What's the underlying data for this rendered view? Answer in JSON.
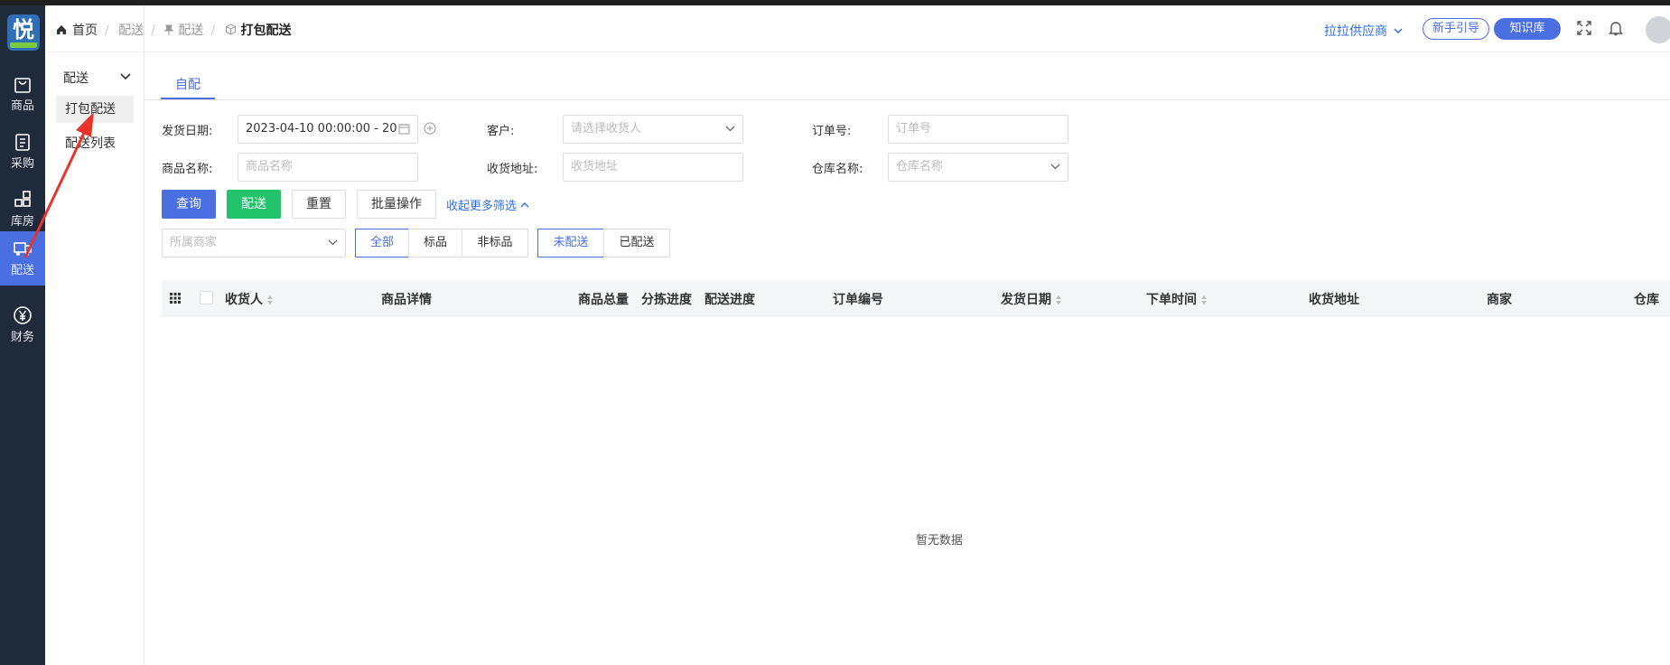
{
  "logo_text": "悦",
  "rail": {
    "items": [
      {
        "label": "商品",
        "icon": "bag-icon"
      },
      {
        "label": "采购",
        "icon": "clipboard-icon"
      },
      {
        "label": "库房",
        "icon": "blocks-icon"
      },
      {
        "label": "配送",
        "icon": "truck-icon",
        "active": true
      },
      {
        "label": "财务",
        "icon": "yen-icon"
      }
    ]
  },
  "submenu": {
    "header": "配送",
    "items": [
      "打包配送",
      "配送列表"
    ]
  },
  "header": {
    "breadcrumb": [
      "首页",
      "配送",
      "配送",
      "打包配送"
    ],
    "supplier": "拉拉供应商",
    "guide_label": "新手引导",
    "kb_label": "知识库"
  },
  "tabs": [
    "自配"
  ],
  "filters": {
    "ship_date_label": "发货日期:",
    "ship_date_value": "2023-04-10 00:00:00 - 20",
    "customer_label": "客户:",
    "customer_placeholder": "请选择收货人",
    "order_no_label": "订单号:",
    "order_no_placeholder": "订单号",
    "product_label": "商品名称:",
    "product_placeholder": "商品名称",
    "address_label": "收货地址:",
    "address_placeholder": "收货地址",
    "warehouse_label": "仓库名称:",
    "warehouse_placeholder": "仓库名称",
    "merchant_placeholder": "所属商家"
  },
  "actions": {
    "query": "查询",
    "deliver": "配送",
    "reset": "重置",
    "batch": "批量操作",
    "collapse": "收起更多筛选"
  },
  "segments": {
    "type": [
      "全部",
      "标品",
      "非标品"
    ],
    "status": [
      "未配送",
      "已配送"
    ]
  },
  "table": {
    "columns": [
      "收货人",
      "商品详情",
      "商品总量",
      "分拣进度",
      "配送进度",
      "订单编号",
      "发货日期",
      "下单时间",
      "收货地址",
      "商家",
      "仓库"
    ],
    "empty_text": "暂无数据"
  },
  "colors": {
    "accent": "#4a6fe0",
    "green": "#23c36b",
    "rail": "#1f2a3a",
    "annotation": "#e8342a"
  }
}
